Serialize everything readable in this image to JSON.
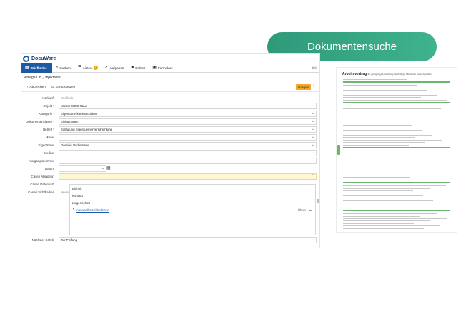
{
  "badge": {
    "label": "Dokumentensuche"
  },
  "app": {
    "brand": "DocuWare",
    "toolbar": [
      {
        "label": "Briefkörbe",
        "icon": "tray-icon",
        "active": true
      },
      {
        "label": "Suchen",
        "icon": "search-icon"
      },
      {
        "label": "Listen",
        "icon": "list-icon",
        "badge": "1"
      },
      {
        "label": "Aufgaben",
        "icon": "check-icon"
      },
      {
        "label": "Ordner",
        "icon": "folder-icon"
      },
      {
        "label": "Formulare",
        "icon": "clipboard-icon"
      }
    ],
    "title": "Ablegen in „Objektakte\"",
    "actions": {
      "cancel": "Abbrechen",
      "reset": "Zurücksetzen",
      "file": "Ablegen"
    },
    "fields": [
      {
        "label": "Herkunft",
        "value": "Briefkorb",
        "readonly": true
      },
      {
        "label": "Objekt *",
        "value": "Muster-WEG Haus",
        "chevron": true
      },
      {
        "label": "Kategorie *",
        "value": "Eigentümerkorrespondenz",
        "chevron": true
      },
      {
        "label": "Dokumentenklasse *",
        "value": "Einladungen",
        "chevron": true
      },
      {
        "label": "Betreff *",
        "value": "Einladung Eigentuemerversammlung",
        "chevron": true
      },
      {
        "label": "Mieter",
        "value": "",
        "chevron": true
      },
      {
        "label": "Eigentümer",
        "value": "Dominic Vodermaier",
        "chevron": true
      },
      {
        "label": "Kreditor",
        "value": "",
        "chevron": true
      },
      {
        "label": "Vorgangsnummer",
        "value": "",
        "chevron": false
      }
    ],
    "date_label": "Datum",
    "caseri_ablageort": {
      "label": "Caseri Ablageort"
    },
    "caseri_datensatz": {
      "label": "Caseri Datensatz"
    },
    "caseri_sichtbarkeit": {
      "label": "Caseri Sichtbarkeit",
      "value": "Neuso"
    },
    "dropdown": {
      "options": [
        "Einheit",
        "Kontakt",
        "Liegenschaft"
      ],
      "link": "Auswahlliste Überleben",
      "filter": "filtern"
    },
    "next_step": {
      "label": "Nächster Schritt",
      "value": "Zur Prüfung"
    }
  },
  "document": {
    "title": "Arbeitsvertrag",
    "subtitle": "für geringfügig & kurzfristig beschäftigte Mitarbeiter sowie Aushilfen"
  }
}
